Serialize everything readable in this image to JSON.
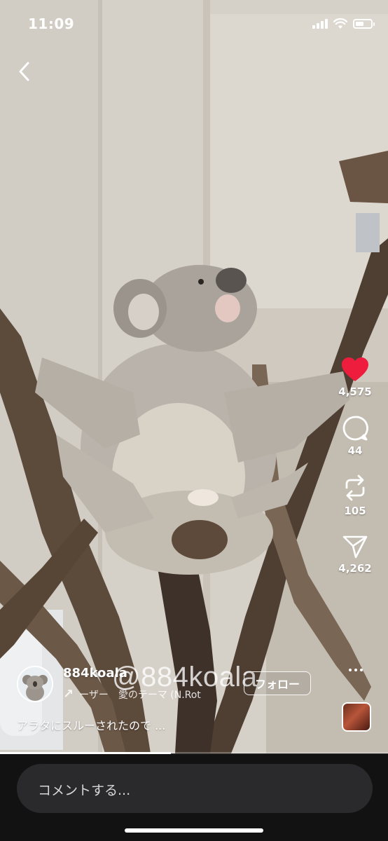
{
  "status_bar": {
    "time": "11:09",
    "battery_level": 0.55
  },
  "navigation": {
    "back_icon": "chevron-left-icon"
  },
  "post": {
    "username": "884koala",
    "audio": "ーザー　愛のテーマ (N.Rot",
    "follow_label": "フォロー",
    "caption": "アラタにスルーされたので ...",
    "watermark": "@884koala"
  },
  "actions": {
    "like_count": "4,575",
    "comment_count": "44",
    "repost_count": "105",
    "share_count": "4,262",
    "like_color": "#ee1d3e"
  },
  "comment_input": {
    "placeholder": "コメントする..."
  },
  "playback": {
    "progress": 0.44
  }
}
